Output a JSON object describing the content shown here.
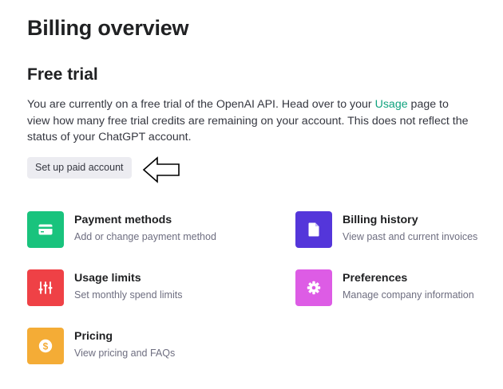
{
  "header": {
    "title": "Billing overview"
  },
  "trial": {
    "title": "Free trial",
    "text_before": "You are currently on a free trial of the OpenAI API. Head over to your ",
    "link_label": "Usage",
    "text_after": " page to view how many free trial credits are remaining on your account. This does not reflect the status of your ChatGPT account.",
    "button_label": "Set up paid account"
  },
  "cards": [
    {
      "title": "Payment methods",
      "desc": "Add or change payment method",
      "icon": "credit-card-icon",
      "color": "#19c37d"
    },
    {
      "title": "Billing history",
      "desc": "View past and current invoices",
      "icon": "document-icon",
      "color": "#5436da"
    },
    {
      "title": "Usage limits",
      "desc": "Set monthly spend limits",
      "icon": "sliders-icon",
      "color": "#ef4146"
    },
    {
      "title": "Preferences",
      "desc": "Manage company information",
      "icon": "gear-icon",
      "color": "#dd5ce5"
    },
    {
      "title": "Pricing",
      "desc": "View pricing and FAQs",
      "icon": "dollar-icon",
      "color": "#f4ac36"
    }
  ]
}
